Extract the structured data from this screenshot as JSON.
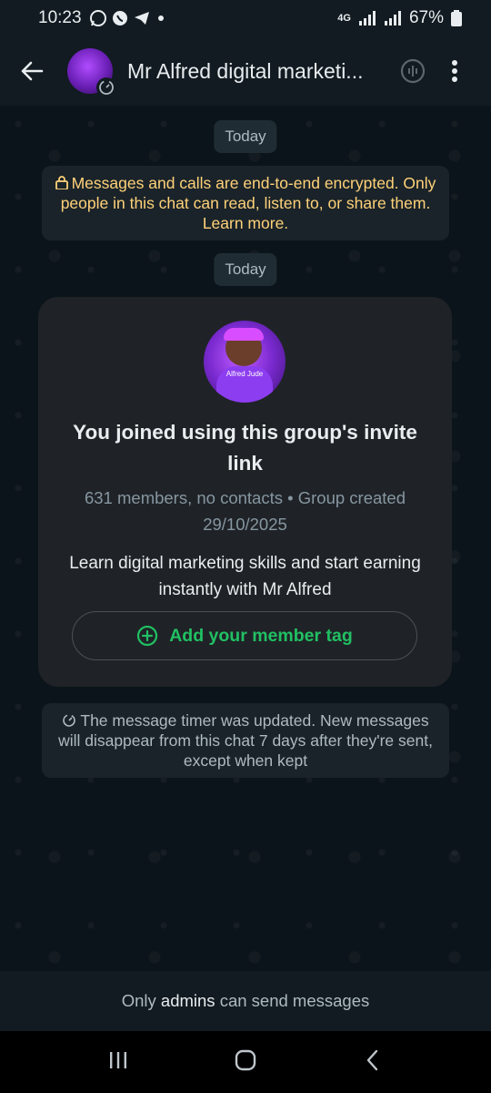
{
  "status_bar": {
    "time": "10:23",
    "network": "4G",
    "battery": "67%"
  },
  "header": {
    "title": "Mr Alfred digital marketi..."
  },
  "chat": {
    "day_label_1": "Today",
    "encryption_notice": "Messages and calls are end-to-end encrypted. Only people in this chat can read, listen to, or share them. Learn more.",
    "day_label_2": "Today",
    "group_card": {
      "avatar_text": "Alfred Jude",
      "joined_text": "You joined using this group's invite link",
      "meta_text": "631 members, no contacts • Group created 29/10/2025",
      "description": "Learn digital marketing skills and start earning instantly with Mr Alfred",
      "add_tag_label": "Add your member tag"
    },
    "timer_notice": "The message timer was updated. New messages will disappear from this chat 7 days after they're sent, except when kept"
  },
  "footer": {
    "prefix": "Only",
    "admins": "admins",
    "suffix": "can send messages"
  },
  "colors": {
    "accent_green": "#21c063",
    "notice_yellow": "#ffd279"
  }
}
